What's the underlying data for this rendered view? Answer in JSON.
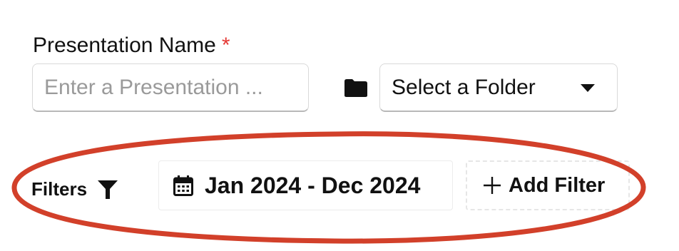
{
  "form": {
    "presentation_name_label": "Presentation Name",
    "required_marker": "*",
    "presentation_name_value": "",
    "presentation_name_placeholder": "Enter a Presentation ...",
    "folder_select_value": "Select a Folder"
  },
  "filters": {
    "label": "Filters",
    "date_range": "Jan 2024 - Dec 2024",
    "add_filter_label": "Add Filter"
  },
  "icons": {
    "folder": "folder-icon",
    "dropdown": "chevron-down-icon",
    "funnel": "filter-funnel-icon",
    "calendar": "calendar-icon",
    "plus": "plus-icon"
  },
  "colors": {
    "required_star": "#e53935",
    "highlight_ellipse": "#d2402a",
    "text": "#111111",
    "placeholder": "#9a9a9a"
  }
}
